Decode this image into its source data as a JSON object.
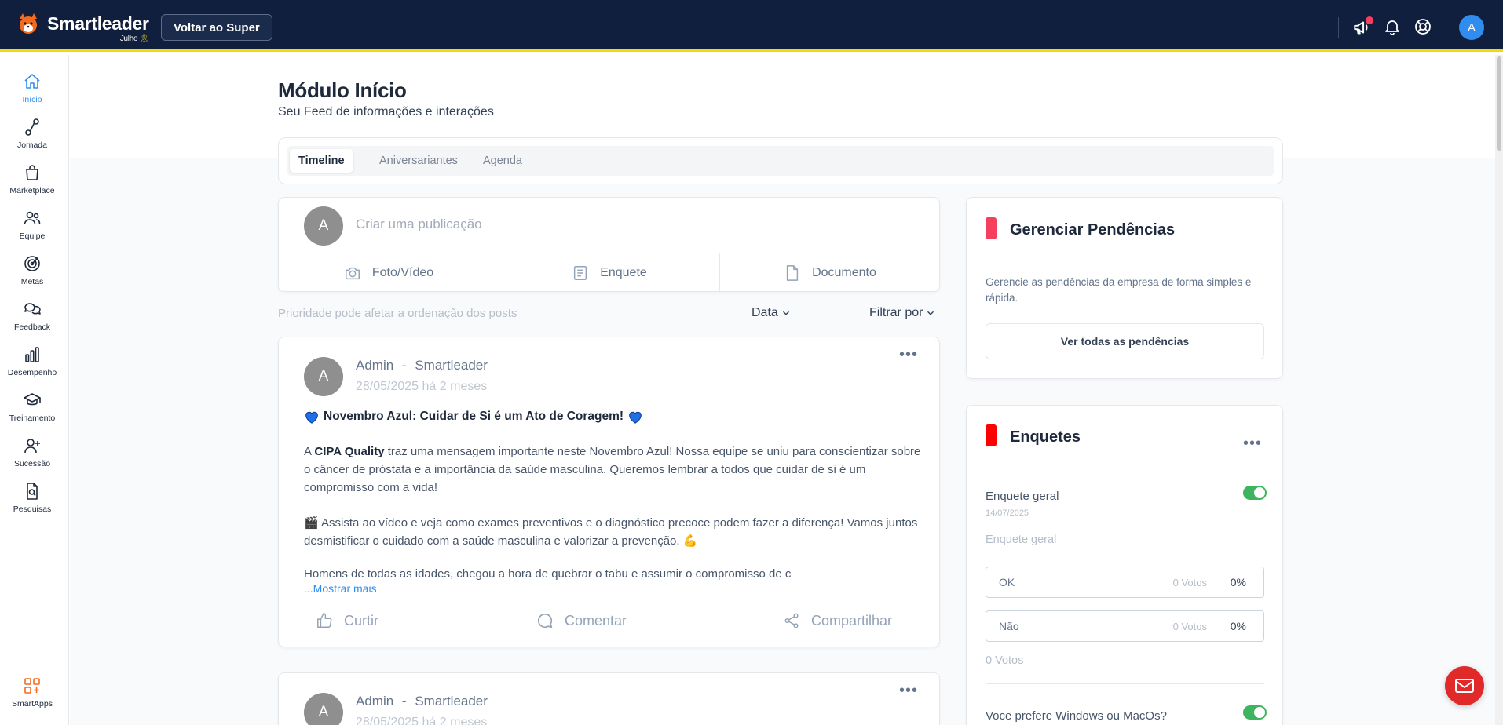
{
  "brand": {
    "name": "Smartleader",
    "sub": "Julho",
    "sub_icon": "ribbon-icon"
  },
  "header": {
    "back_button": "Voltar ao Super",
    "icons": [
      "megaphone-icon",
      "bell-icon",
      "help-lifebuoy-icon"
    ],
    "avatar_initial": "A"
  },
  "sidebar": {
    "items": [
      {
        "label": "Início",
        "icon": "home-icon",
        "active": true
      },
      {
        "label": "Jornada",
        "icon": "route-icon"
      },
      {
        "label": "Marketplace",
        "icon": "shopping-bag-icon"
      },
      {
        "label": "Equipe",
        "icon": "users-icon"
      },
      {
        "label": "Metas",
        "icon": "target-icon"
      },
      {
        "label": "Feedback",
        "icon": "chat-bubbles-icon"
      },
      {
        "label": "Desempenho",
        "icon": "bar-chart-icon"
      },
      {
        "label": "Treinamento",
        "icon": "graduation-cap-icon"
      },
      {
        "label": "Sucessão",
        "icon": "user-plus-icon"
      },
      {
        "label": "Pesquisas",
        "icon": "file-search-icon"
      }
    ],
    "bottom": {
      "label": "SmartApps",
      "icon": "apps-grid-icon"
    }
  },
  "page": {
    "title": "Módulo Início",
    "subtitle": "Seu Feed de informações e interações",
    "tabs": [
      {
        "label": "Timeline",
        "active": true
      },
      {
        "label": "Aniversariantes"
      },
      {
        "label": "Agenda"
      }
    ]
  },
  "compose": {
    "avatar_initial": "A",
    "placeholder": "Criar uma publicação",
    "actions": [
      {
        "label": "Foto/Vídeo",
        "icon": "camera-icon"
      },
      {
        "label": "Enquete",
        "icon": "poll-icon"
      },
      {
        "label": "Documento",
        "icon": "document-icon"
      }
    ]
  },
  "feed": {
    "priority_note": "Prioridade pode afetar a ordenação dos posts",
    "sort_label": "Data",
    "filter_label": "Filtrar por"
  },
  "posts": [
    {
      "avatar_initial": "A",
      "author": "Admin",
      "author_sep": "-",
      "company": "Smartleader",
      "date": "28/05/2025 há 2 meses",
      "title": "Novembro Azul: Cuidar de Si é um Ato de Coragem!",
      "body_p1_prefix": "A ",
      "body_p1_bold": "CIPA Quality",
      "body_p1_rest": " traz uma mensagem importante neste Novembro Azul! Nossa equipe se uniu para conscientizar sobre o câncer de próstata e a importância da saúde masculina. Queremos lembrar a todos que cuidar de si é um compromisso com a vida!",
      "body_p2_emoji": "🎬",
      "body_p2": " Assista ao vídeo e veja como exames preventivos e o diagnóstico precoce podem fazer a diferença! Vamos juntos desmistificar o cuidado com a saúde masculina e valorizar a prevenção. ",
      "body_p2_emoji_end": "💪",
      "body_p3": "Homens de todas as idades, chegou a hora de quebrar o tabu e assumir o compromisso de c",
      "show_more": "...Mostrar mais",
      "actions": {
        "like": "Curtir",
        "comment": "Comentar",
        "share": "Compartilhar"
      }
    },
    {
      "avatar_initial": "A",
      "author": "Admin",
      "author_sep": "-",
      "company": "Smartleader",
      "date": "28/05/2025 há 2 meses"
    }
  ],
  "pendencias": {
    "title": "Gerenciar Pendências",
    "description": "Gerencie as pendências da empresa de forma simples e rápida.",
    "button": "Ver todas as pendências",
    "accent": "#f43f5e"
  },
  "enquetes": {
    "title": "Enquetes",
    "accent": "#ff0000",
    "polls": [
      {
        "name": "Enquete geral",
        "date": "14/07/2025",
        "question": "Enquete geral",
        "active": true,
        "options": [
          {
            "label": "OK",
            "votes": "0 Votos",
            "percent": "0%"
          },
          {
            "label": "Não",
            "votes": "0 Votos",
            "percent": "0%"
          }
        ],
        "total": "0 Votos"
      },
      {
        "name": "Voce prefere Windows ou MacOs?",
        "active": true
      }
    ]
  },
  "colors": {
    "topbar": "#0f1f3d",
    "topbar_border": "#f5d90a",
    "accent_blue": "#2f8df0",
    "fab": "#e02a2a",
    "toggle_on": "#3db55f"
  }
}
